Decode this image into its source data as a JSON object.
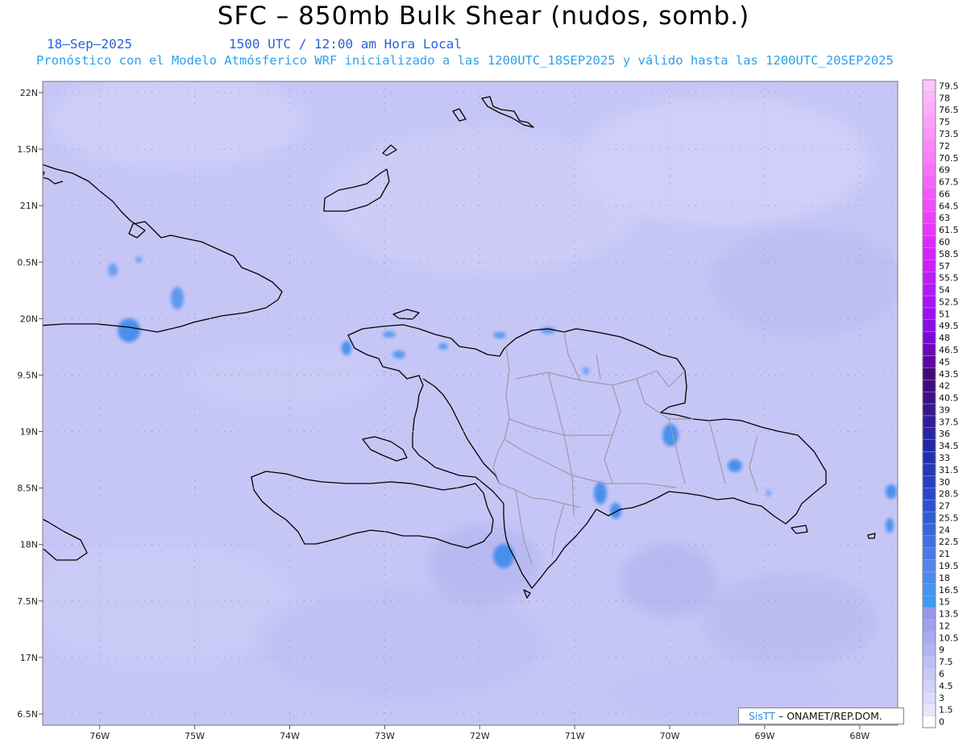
{
  "header": {
    "title": "SFC – 850mb Bulk Shear (nudos, somb.)",
    "date": "18–Sep–2025",
    "time": "1500 UTC / 12:00 am Hora Local",
    "info": "Pronóstico con el Modelo Atmósferico WRF inicializado a las 1200UTC_18SEP2025 y válido hasta las  1200UTC_20SEP2025"
  },
  "credit": {
    "brand": "SisTT",
    "agency": "– ONAMET/REP.DOM."
  },
  "axes": {
    "lon_range": [
      -76.6,
      -67.6
    ],
    "lat_range": [
      16.4,
      22.1
    ],
    "lon_ticks": [
      {
        "value": -76,
        "label": "76W"
      },
      {
        "value": -75,
        "label": "75W"
      },
      {
        "value": -74,
        "label": "74W"
      },
      {
        "value": -73,
        "label": "73W"
      },
      {
        "value": -72,
        "label": "72W"
      },
      {
        "value": -71,
        "label": "71W"
      },
      {
        "value": -70,
        "label": "70W"
      },
      {
        "value": -69,
        "label": "69W"
      },
      {
        "value": -68,
        "label": "68W"
      }
    ],
    "lat_ticks": [
      {
        "value": 22,
        "label": "22N"
      },
      {
        "value": 21.5,
        "label": "1.5N"
      },
      {
        "value": 21,
        "label": "21N"
      },
      {
        "value": 20.5,
        "label": "0.5N"
      },
      {
        "value": 20,
        "label": "20N"
      },
      {
        "value": 19.5,
        "label": "9.5N"
      },
      {
        "value": 19,
        "label": "19N"
      },
      {
        "value": 18.5,
        "label": "8.5N"
      },
      {
        "value": 18,
        "label": "18N"
      },
      {
        "value": 17.5,
        "label": "7.5N"
      },
      {
        "value": 17,
        "label": "17N"
      },
      {
        "value": 16.5,
        "label": "6.5N"
      }
    ],
    "grid": true
  },
  "colorbar": {
    "labels": [
      "0",
      "1.5",
      "3",
      "4.5",
      "6",
      "7.5",
      "9",
      "10.5",
      "12",
      "13.5",
      "15",
      "16.5",
      "18",
      "19.5",
      "21",
      "22.5",
      "24",
      "25.5",
      "27",
      "28.5",
      "30",
      "31.5",
      "33",
      "34.5",
      "36",
      "37.5",
      "39",
      "40.5",
      "42",
      "43.5",
      "45",
      "46.5",
      "48",
      "49.5",
      "51",
      "52.5",
      "54",
      "55.5",
      "57",
      "58.5",
      "60",
      "61.5",
      "63",
      "64.5",
      "66",
      "67.5",
      "69",
      "70.5",
      "72",
      "73.5",
      "75",
      "76.5",
      "78",
      "79.5"
    ],
    "colors": [
      "#ffffff",
      "#e6e6ff",
      "#dcdcfc",
      "#d2d2fa",
      "#c8c8f8",
      "#bebef6",
      "#b4b4f4",
      "#aaaaf2",
      "#a0a0f0",
      "#9696ee",
      "#3c9cf4",
      "#4494f2",
      "#4c8cf0",
      "#5484ee",
      "#4a7ae8",
      "#4070e2",
      "#3866dc",
      "#305cd6",
      "#2c52cf",
      "#2848c8",
      "#2640c0",
      "#2438b8",
      "#2230b0",
      "#2028a8",
      "#2a24a0",
      "#301e98",
      "#361890",
      "#3c1088",
      "#420a80",
      "#480678",
      "#5a08a0",
      "#6a0ab8",
      "#7a0cd0",
      "#8a0ee4",
      "#9a10f0",
      "#a814f4",
      "#b418f6",
      "#c01cf8",
      "#cc20fa",
      "#d624fb",
      "#e02afc",
      "#e834fc",
      "#ee40fc",
      "#f24cfc",
      "#f458fc",
      "#f664fc",
      "#f870fc",
      "#fa7cfc",
      "#fb88fc",
      "#fc94fc",
      "#fca0fc",
      "#fcacfc",
      "#fcb8fc",
      "#fcc4fc"
    ]
  }
}
